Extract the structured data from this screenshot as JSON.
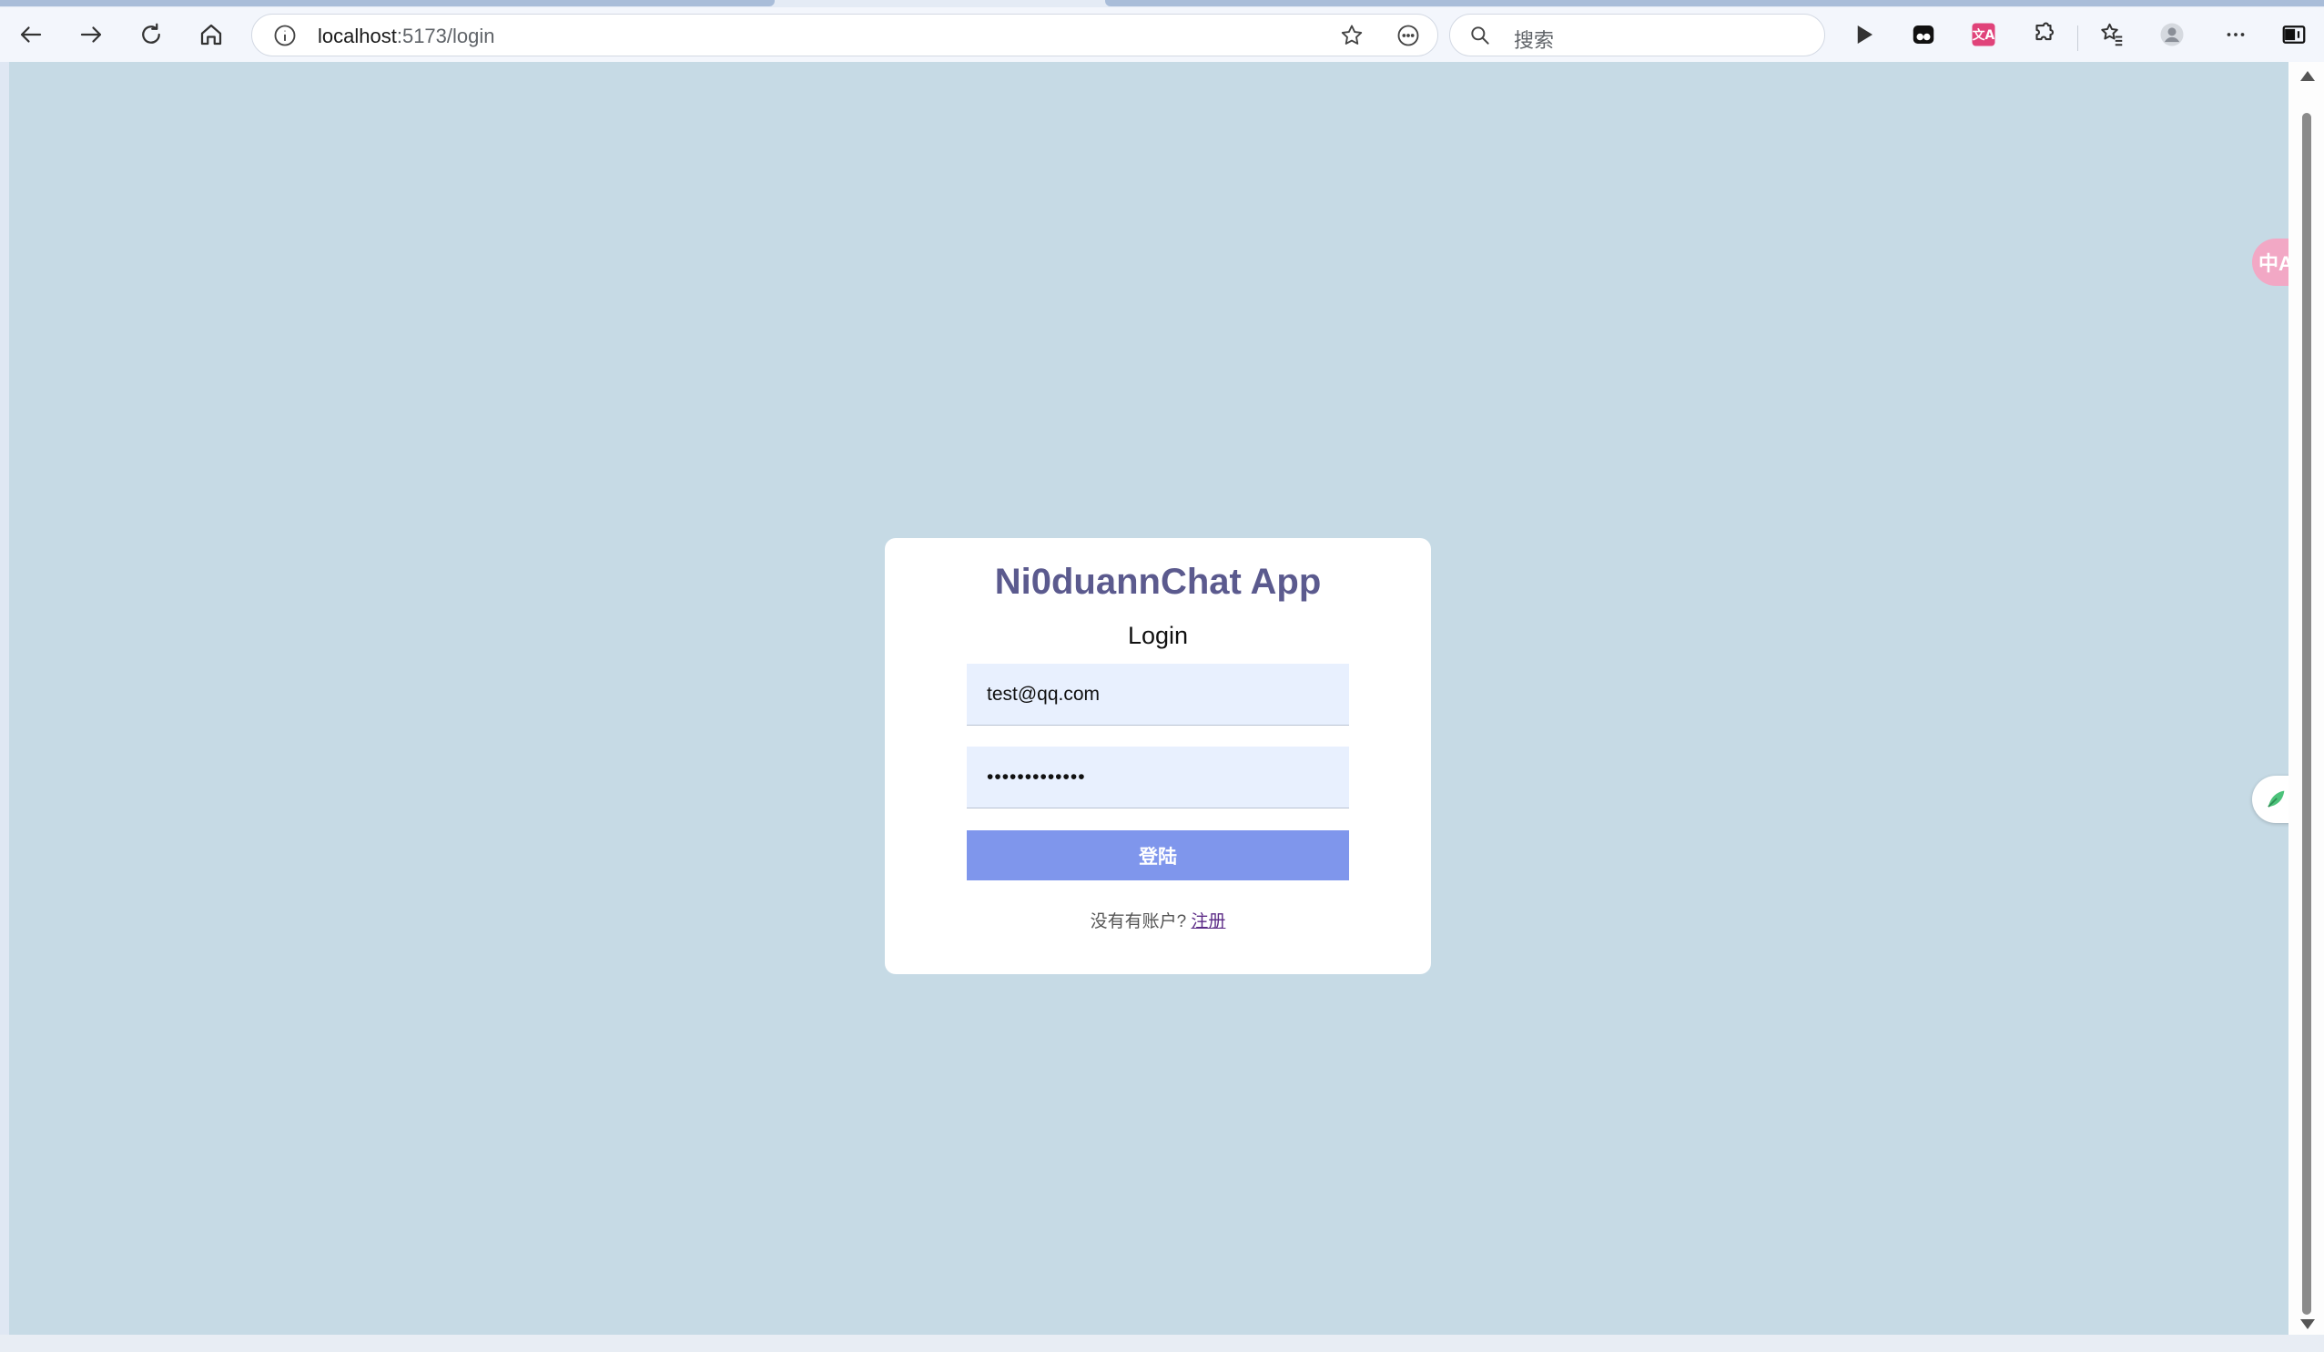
{
  "browser": {
    "url_host": "localhost",
    "url_path": ":5173/login",
    "search_placeholder": "搜索",
    "icons": {
      "back": "back-arrow-icon",
      "forward": "forward-arrow-icon",
      "refresh": "refresh-icon",
      "home": "home-icon",
      "info": "info-icon",
      "favorite": "star-icon",
      "reader": "more-circle-icon",
      "search": "search-icon",
      "play": "play-icon",
      "extension_1": "app-icon",
      "extension_2": "translate-icon",
      "extensions": "puzzle-icon",
      "favorites": "favorites-icon",
      "profile": "avatar-icon",
      "menu": "ellipsis-icon",
      "sidebar": "sidebar-icon"
    }
  },
  "login": {
    "app_title": "Ni0duannChat App",
    "heading": "Login",
    "email_value": "test@qq.com",
    "password_value": "•••••••••••••",
    "submit_label": "登陆",
    "signup_prompt": "没有有账户?",
    "signup_link": "注册"
  },
  "floating": {
    "translate_label": "中A"
  },
  "colors": {
    "page_background": "#c6dae5",
    "card_background": "#ffffff",
    "title_color": "#5b5a8e",
    "input_background": "#e8f0fe",
    "button_background": "#7f96ec",
    "link_color": "#5b2a86"
  }
}
